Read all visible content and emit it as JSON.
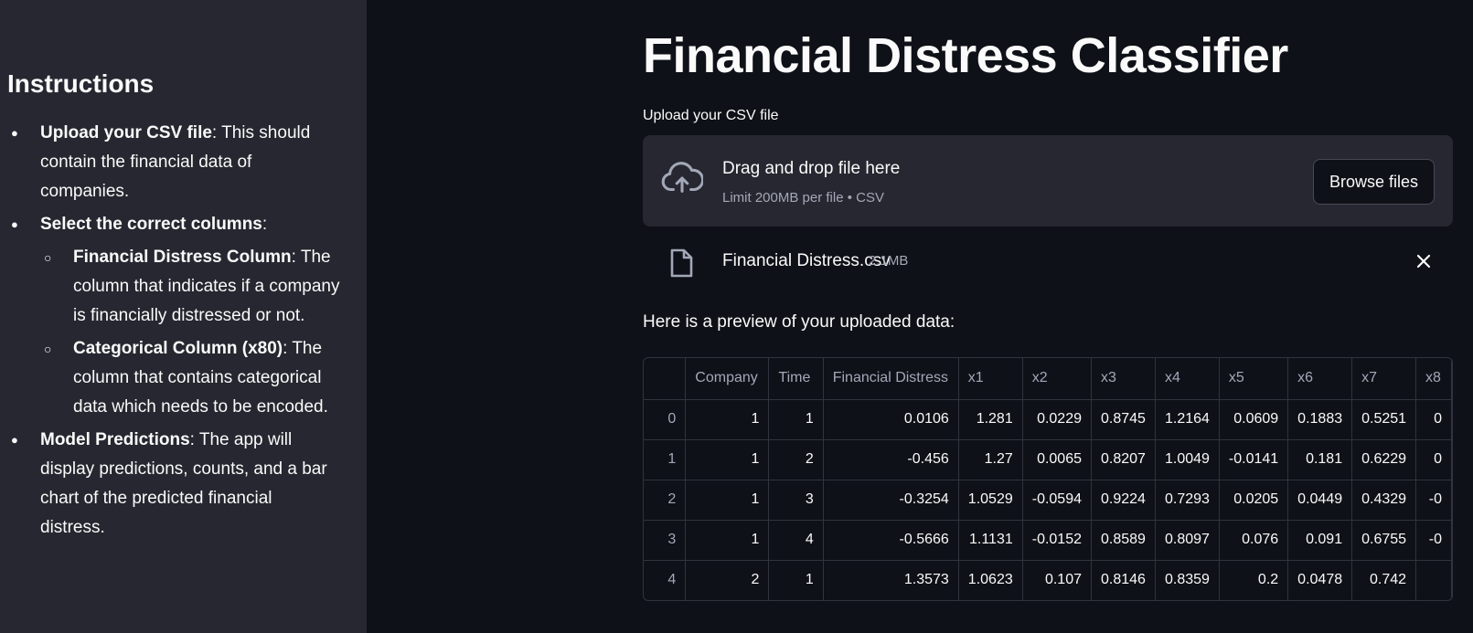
{
  "sidebar": {
    "title": "Instructions",
    "items": [
      {
        "bold": "Upload your CSV file",
        "text": ": This should contain the financial data of companies."
      },
      {
        "bold": "Select the correct columns",
        "text": ":",
        "subitems": [
          {
            "bold": "Financial Distress Column",
            "text": ": The column that indicates if a company is financially distressed or not."
          },
          {
            "bold": "Categorical Column (x80)",
            "text": ": The column that contains categorical data which needs to be encoded."
          }
        ]
      },
      {
        "bold": "Model Predictions",
        "text": ": The app will display predictions, counts, and a bar chart of the predicted financial distress."
      }
    ]
  },
  "main": {
    "title": "Financial Distress Classifier",
    "upload_label": "Upload your CSV file",
    "dropzone": {
      "main_text": "Drag and drop file here",
      "sub_text": "Limit 200MB per file • CSV",
      "button_label": "Browse files",
      "icon": "cloud-upload-icon"
    },
    "file": {
      "name": "Financial Distress.csv",
      "size": "2.1MB",
      "icon": "file-icon"
    },
    "preview_label": "Here is a preview of your uploaded data:",
    "table": {
      "columns": [
        "",
        "Company",
        "Time",
        "Financial Distress",
        "x1",
        "x2",
        "x3",
        "x4",
        "x5",
        "x6",
        "x7",
        "x8"
      ],
      "rows": [
        [
          "0",
          "1",
          "1",
          "0.0106",
          "1.281",
          "0.0229",
          "0.8745",
          "1.2164",
          "0.0609",
          "0.1883",
          "0.5251",
          "0"
        ],
        [
          "1",
          "1",
          "2",
          "-0.456",
          "1.27",
          "0.0065",
          "0.8207",
          "1.0049",
          "-0.0141",
          "0.181",
          "0.6229",
          "0"
        ],
        [
          "2",
          "1",
          "3",
          "-0.3254",
          "1.0529",
          "-0.0594",
          "0.9224",
          "0.7293",
          "0.0205",
          "0.0449",
          "0.4329",
          "-0"
        ],
        [
          "3",
          "1",
          "4",
          "-0.5666",
          "1.1131",
          "-0.0152",
          "0.8589",
          "0.8097",
          "0.076",
          "0.091",
          "0.6755",
          "-0"
        ],
        [
          "4",
          "2",
          "1",
          "1.3573",
          "1.0623",
          "0.107",
          "0.8146",
          "0.8359",
          "0.2",
          "0.0478",
          "0.742",
          ""
        ]
      ]
    }
  },
  "colors": {
    "background": "#0e1117",
    "sidebar": "#262730",
    "text": "#fafafa",
    "muted": "#a3a8b8",
    "border": "#31333f"
  }
}
